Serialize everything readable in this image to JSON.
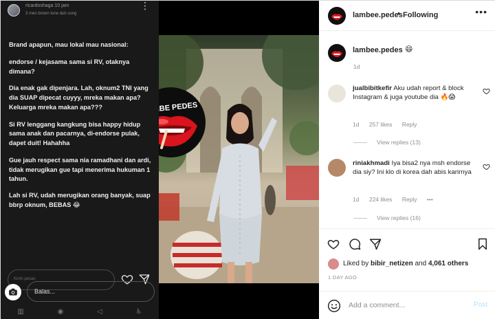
{
  "story": {
    "username": "ricardoshaga  10 jam",
    "music": "3 men brown tone dub song",
    "text": [
      "Brand apapun, mau lokal mau nasional:",
      "endorse / kejasama sama si RV, otaknya dimana?",
      "Dia enak gak dipenjara. Lah, oknum2 TNI yang dia SUAP dipecat cuyyy, mreka makan apa? Keluarga mreka makan apa???",
      "Si RV lenggang kangkung bisa happy hidup sama anak dan pacarnya, di-endorse pulak, dapet duit! Hahahha",
      "Gue jauh respect sama nia ramadhani dan ardi, tidak merugikan gue tapi menerima hukuman 1 tahun.",
      "Lah si RV, udah merugikan orang banyak, suap bbrp oknum, BEBAS 😂"
    ],
    "reply_hint": "Kirim pesan",
    "reply_placeholder": "Balas..."
  },
  "photo": {
    "badge_text": "LAMBE PEDES"
  },
  "instagram": {
    "header": {
      "username": "lambee.pedes",
      "dot": "•",
      "follow": "Following",
      "more": "•••"
    },
    "caption": {
      "username": "lambee.pedes",
      "emoji": "😄",
      "time": "1d"
    },
    "comments": [
      {
        "username": "jualbibitkefir",
        "text": "Aku udah report & block Instagram & juga youtube dia 🔥😱",
        "time": "1d",
        "likes": "257 likes",
        "reply": "Reply",
        "view_replies": "View replies (13)"
      },
      {
        "username": "riniakhmadi",
        "text": "Iya bisa2 nya msh endorse dia siy? Ini klo di korea dah abis karirnya",
        "time": "1d",
        "likes": "224 likes",
        "reply": "Reply",
        "more": "•••",
        "view_replies": "View replies (16)"
      }
    ],
    "liked_by": {
      "prefix": "Liked by",
      "user": "bibir_netizen",
      "middle": "and",
      "count": "4,061 others"
    },
    "date": "1 DAY AGO",
    "comment_placeholder": "Add a comment...",
    "post_label": "Post"
  },
  "colors": {
    "brand_red": "#b3001b",
    "muted": "#8e8e8e",
    "post_disabled": "#b2dffc"
  }
}
